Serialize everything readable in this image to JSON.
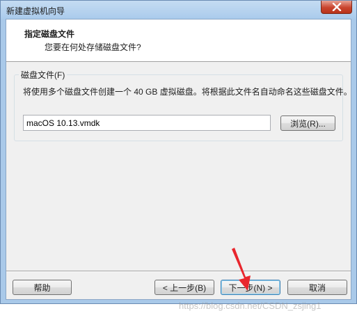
{
  "window": {
    "title": "新建虚拟机向导"
  },
  "header": {
    "title": "指定磁盘文件",
    "subtitle": "您要在何处存储磁盘文件?"
  },
  "disk_group": {
    "label": "磁盘文件(F)",
    "description": "将使用多个磁盘文件创建一个 40 GB 虚拟磁盘。将根据此文件名自动命名这些磁盘文件。",
    "file_name": "macOS 10.13.vmdk",
    "browse_label": "浏览(R)..."
  },
  "footer": {
    "help_label": "帮助",
    "back_label": "< 上一步(B)",
    "next_label": "下一步(N) >",
    "cancel_label": "取消"
  },
  "annotation": {
    "arrow_color": "#e8262d"
  },
  "watermark": {
    "text": "https://blog.csdn.net/CSDN_zsjing1"
  }
}
